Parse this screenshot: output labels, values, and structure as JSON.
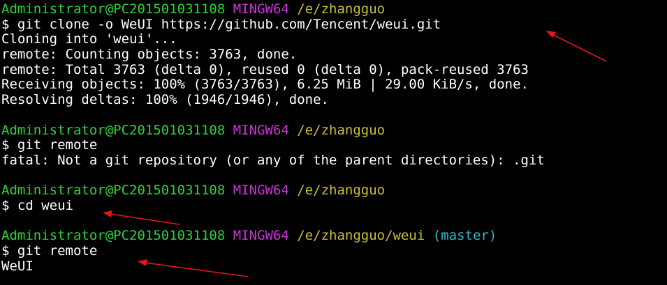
{
  "blocks": [
    {
      "prompt": {
        "user": "Administrator@PC201501031108",
        "system": "MINGW64",
        "path": "/e/zhangguo",
        "branch": ""
      },
      "command": "$ git clone -o WeUI https://github.com/Tencent/weui.git",
      "output": [
        "Cloning into 'weui'...",
        "remote: Counting objects: 3763, done.",
        "remote: Total 3763 (delta 0), reused 0 (delta 0), pack-reused 3763",
        "Receiving objects: 100% (3763/3763), 6.25 MiB | 29.00 KiB/s, done.",
        "Resolving deltas: 100% (1946/1946), done."
      ]
    },
    {
      "prompt": {
        "user": "Administrator@PC201501031108",
        "system": "MINGW64",
        "path": "/e/zhangguo",
        "branch": ""
      },
      "command": "$ git remote",
      "output": [
        "fatal: Not a git repository (or any of the parent directories): .git"
      ]
    },
    {
      "prompt": {
        "user": "Administrator@PC201501031108",
        "system": "MINGW64",
        "path": "/e/zhangguo",
        "branch": ""
      },
      "command": "$ cd weui",
      "output": []
    },
    {
      "prompt": {
        "user": "Administrator@PC201501031108",
        "system": "MINGW64",
        "path": "/e/zhangguo/weui",
        "branch": "(master)"
      },
      "command": "$ git remote",
      "output": [
        "WeUI"
      ]
    }
  ],
  "colors": {
    "background": "#000000",
    "user": "#2fd13b",
    "system": "#c634d3",
    "path": "#c7c233",
    "branch": "#36b8c8",
    "text": "#ffffff",
    "annotation_arrow": "#e8141c"
  }
}
